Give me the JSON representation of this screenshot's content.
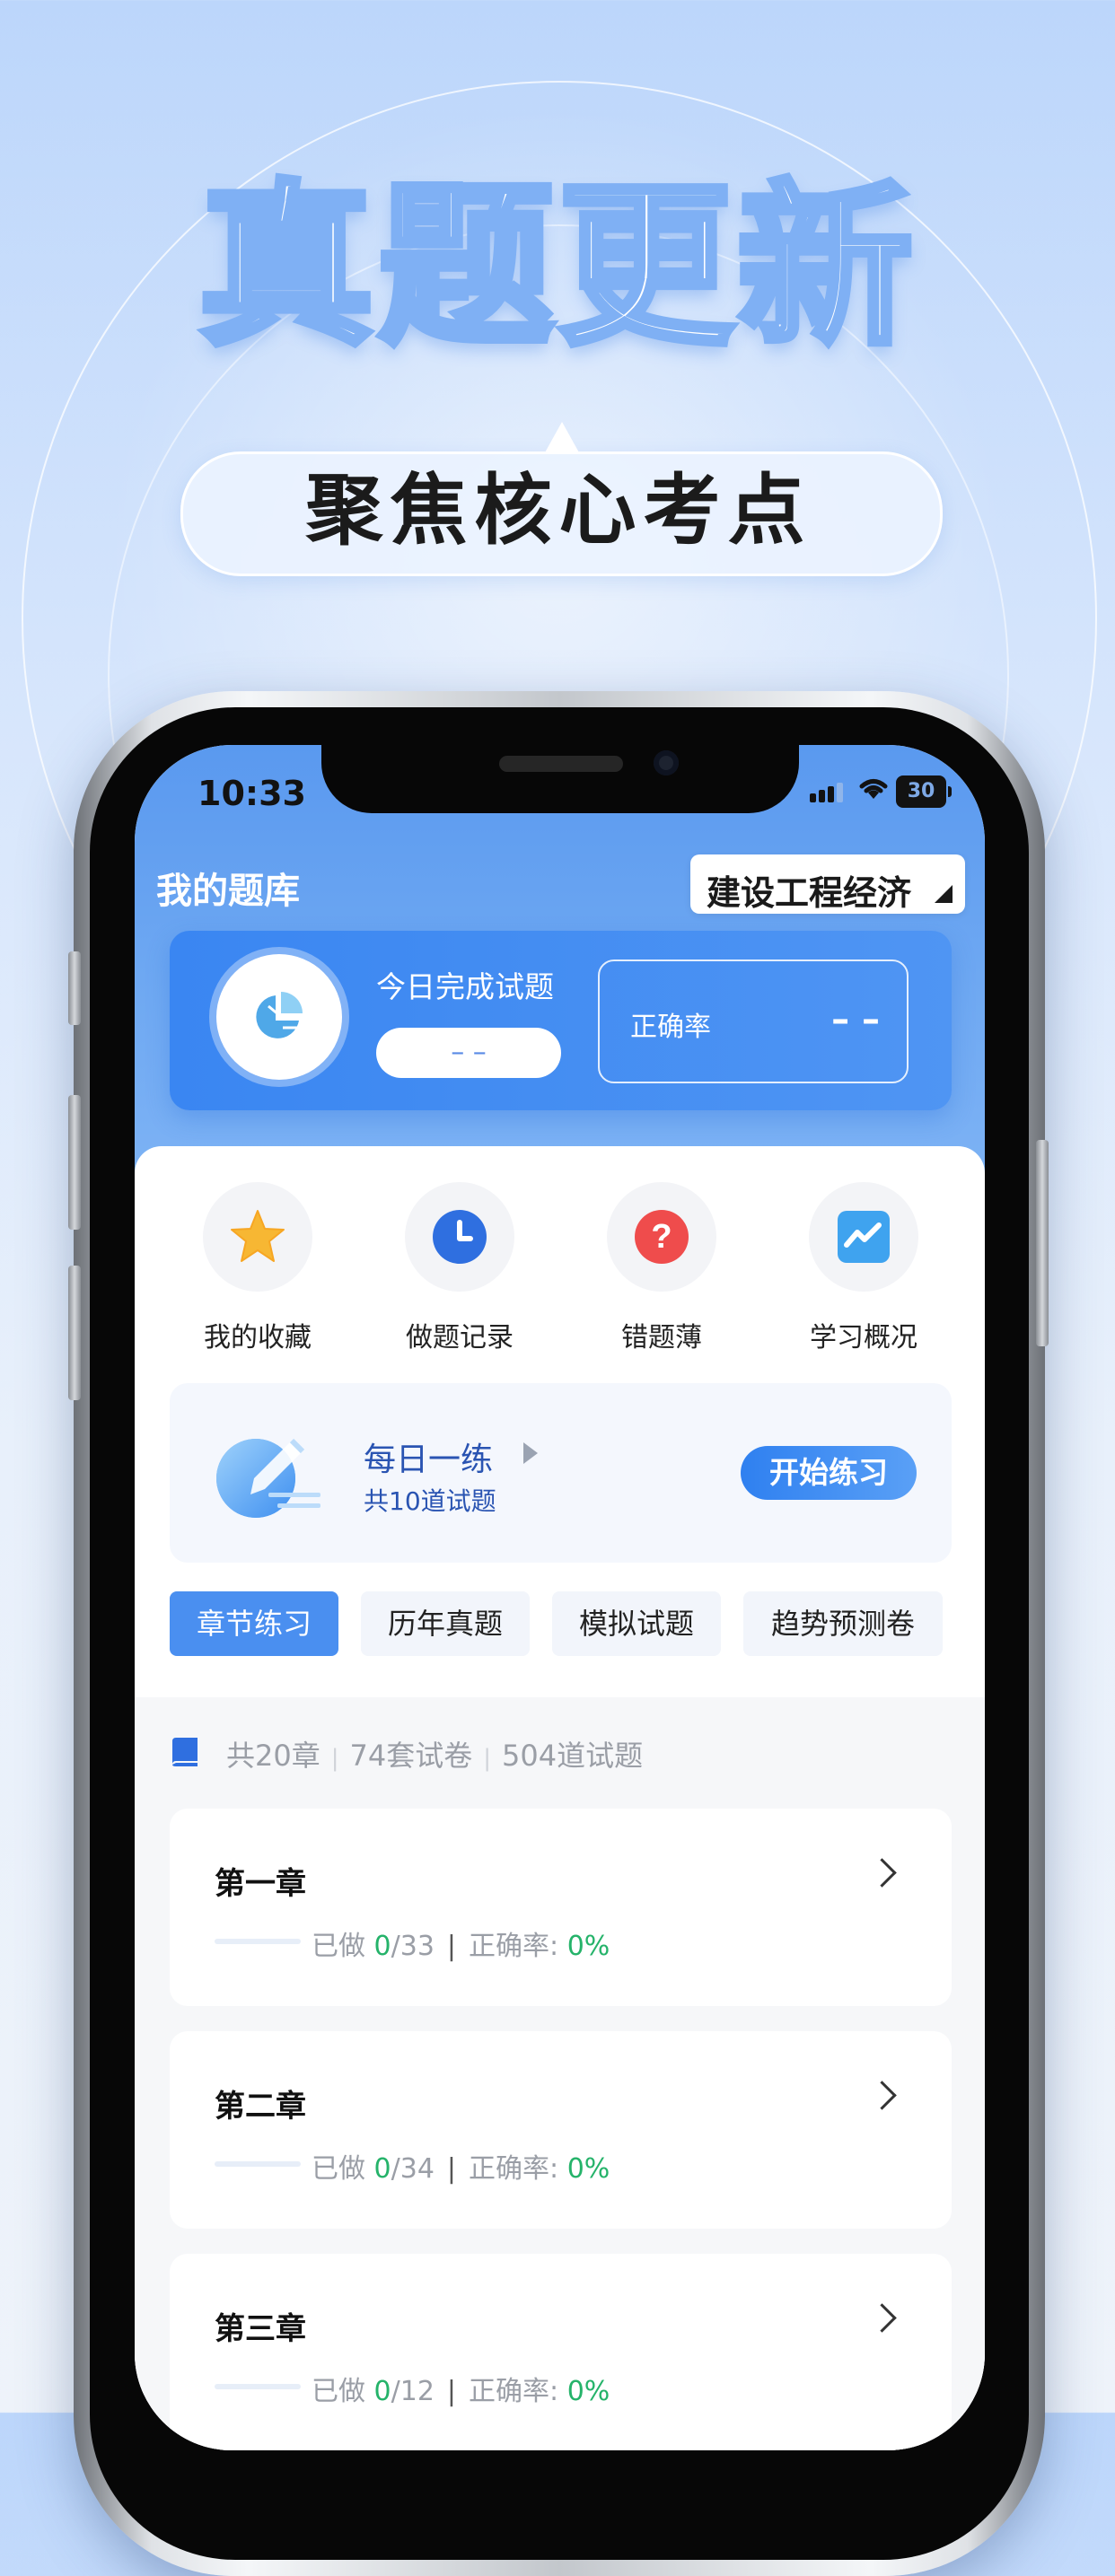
{
  "hero": {
    "title": "真题更新",
    "subtitle": "聚焦核心考点"
  },
  "status_bar": {
    "time": "10:33",
    "battery": "30"
  },
  "header": {
    "title": "我的题库",
    "subject": "建设工程经济"
  },
  "stats": {
    "today_label": "今日完成试题",
    "today_value": "– –",
    "accuracy_label": "正确率",
    "accuracy_value": "– –"
  },
  "features": [
    {
      "label": "我的收藏",
      "icon": "star-icon"
    },
    {
      "label": "做题记录",
      "icon": "clock-icon"
    },
    {
      "label": "错题薄",
      "icon": "question-icon"
    },
    {
      "label": "学习概况",
      "icon": "trend-chart-icon"
    }
  ],
  "daily": {
    "title": "每日一练",
    "subtitle": "共10道试题",
    "button": "开始练习"
  },
  "tabs": [
    "章节练习",
    "历年真题",
    "模拟试题",
    "趋势预测卷"
  ],
  "summary": {
    "chapters": "共20章",
    "papers": "74套试卷",
    "questions": "504道试题"
  },
  "chapter_labels": {
    "done": "已做",
    "accuracy": "正确率:"
  },
  "chapters": [
    {
      "title": "第一章",
      "done": "0",
      "total": "/33",
      "accuracy": "0%"
    },
    {
      "title": "第二章",
      "done": "0",
      "total": "/34",
      "accuracy": "0%"
    },
    {
      "title": "第三章",
      "done": "0",
      "total": "/12",
      "accuracy": "0%"
    }
  ],
  "colors": {
    "accent": "#4a8ff0",
    "header_blue": "#5a99ef",
    "success_green": "#25b36a"
  }
}
